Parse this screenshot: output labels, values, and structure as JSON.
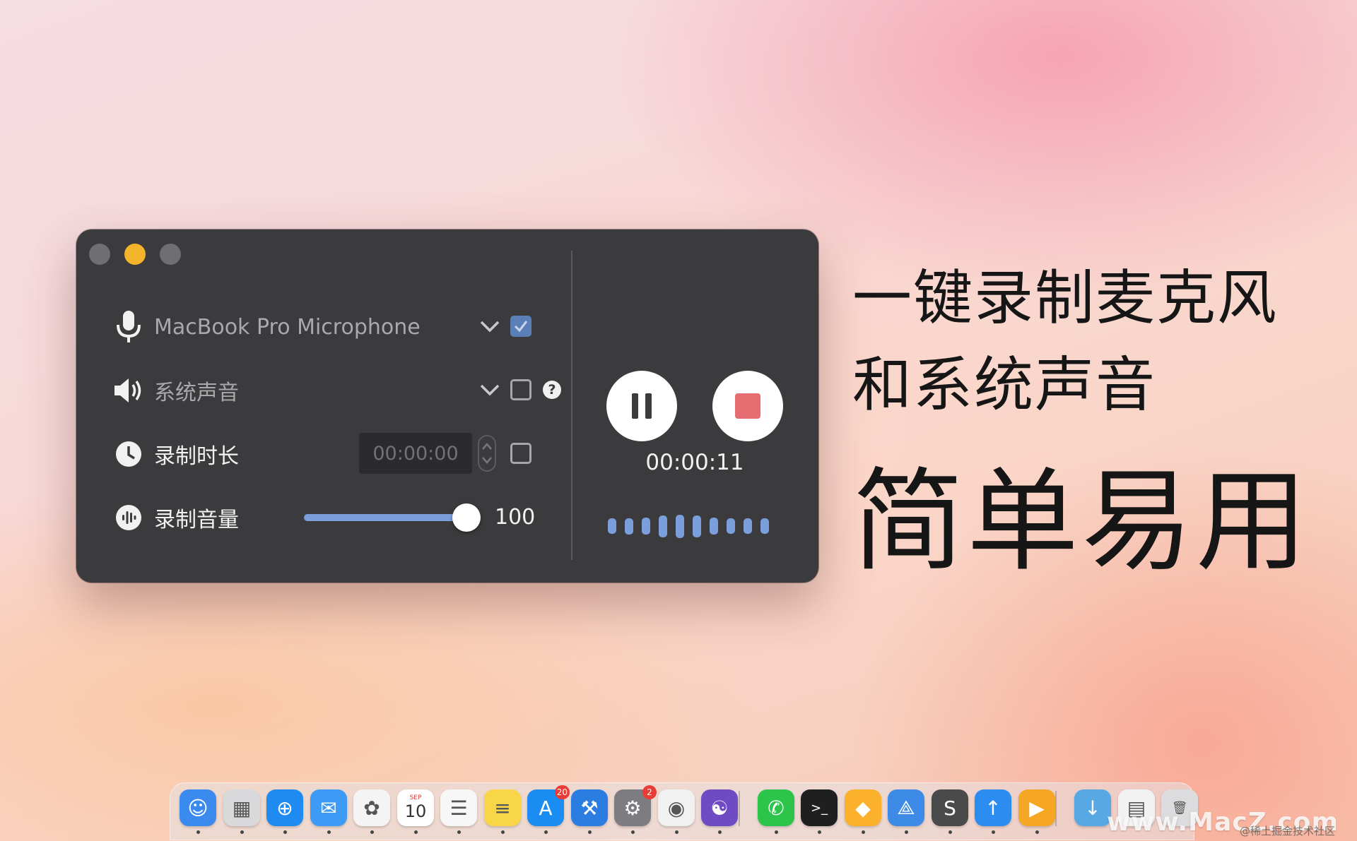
{
  "window": {
    "inputs": [
      {
        "label": "MacBook Pro Microphone",
        "icon": "microphone-icon",
        "checked": true
      },
      {
        "label": "系统声音",
        "icon": "speaker-icon",
        "checked": false,
        "help": "?"
      }
    ],
    "duration": {
      "label": "录制时长",
      "icon": "clock-icon",
      "value": "00:00:00",
      "checked": false
    },
    "volume": {
      "label": "录制音量",
      "icon": "waveform-circle-icon",
      "value": "100",
      "level_percent": 100
    },
    "controls": {
      "pause": "pause-icon",
      "stop": "stop-icon"
    },
    "timer": "00:00:11",
    "waveform_levels": [
      0.45,
      0.5,
      0.55,
      0.85,
      0.95,
      0.85,
      0.55,
      0.45,
      0.45,
      0.45
    ],
    "accent_color": "#7a9fdb",
    "stop_color": "#e56d72",
    "checkbox_color": "#5b80b8"
  },
  "headline": {
    "line1": "一键录制麦克风",
    "line2": "和系统声音",
    "line3": "简单易用"
  },
  "dock": {
    "apps": [
      {
        "name": "finder-icon",
        "color": "#3b8bef",
        "glyph": "☺"
      },
      {
        "name": "launchpad-icon",
        "color": "#d9d9dc",
        "glyph": "▦"
      },
      {
        "name": "safari-icon",
        "color": "#1f8af0",
        "glyph": "⊕"
      },
      {
        "name": "mail-icon",
        "color": "#3d9bf5",
        "glyph": "✉"
      },
      {
        "name": "photos-icon",
        "color": "#f4f4f4",
        "glyph": "✿"
      },
      {
        "name": "calendar-icon",
        "color": "#ffffff",
        "glyph": "10",
        "sub": "SEP"
      },
      {
        "name": "reminders-icon",
        "color": "#f7f7f7",
        "glyph": "☰"
      },
      {
        "name": "notes-icon",
        "color": "#f9d548",
        "glyph": "≡"
      },
      {
        "name": "app-store-icon",
        "color": "#1a8cf2",
        "glyph": "A",
        "badge": "20"
      },
      {
        "name": "xcode-icon",
        "color": "#2b7de1",
        "glyph": "⚒"
      },
      {
        "name": "system-preferences-icon",
        "color": "#7d7d81",
        "glyph": "⚙",
        "badge": "2"
      },
      {
        "name": "chrome-icon",
        "color": "#f1f1f1",
        "glyph": "◉"
      },
      {
        "name": "github-icon",
        "color": "#6e4bc2",
        "glyph": "☯"
      },
      {
        "name": "wechat-icon",
        "color": "#2dc44c",
        "glyph": "✆"
      },
      {
        "name": "terminal-icon",
        "color": "#1f1f1f",
        "glyph": ">_"
      },
      {
        "name": "sketch-icon",
        "color": "#fbb12c",
        "glyph": "◆"
      },
      {
        "name": "tripmode-icon",
        "color": "#3d8be6",
        "glyph": "⟁"
      },
      {
        "name": "sublime-icon",
        "color": "#4a4a4a",
        "glyph": "S"
      },
      {
        "name": "transmit-icon",
        "color": "#2c8cf0",
        "glyph": "↑"
      },
      {
        "name": "infuse-icon",
        "color": "#f5a623",
        "glyph": "▶"
      },
      {
        "name": "downloads-folder-icon",
        "color": "#58a8e5",
        "glyph": "↓"
      },
      {
        "name": "stack-folder-icon",
        "color": "#f2f2f2",
        "glyph": "▤"
      },
      {
        "name": "trash-icon",
        "color": "#dcdcdf",
        "glyph": "🗑"
      }
    ]
  },
  "watermark": {
    "main": "www.MacZ.com",
    "sub": "@稀土掘金技术社区"
  }
}
